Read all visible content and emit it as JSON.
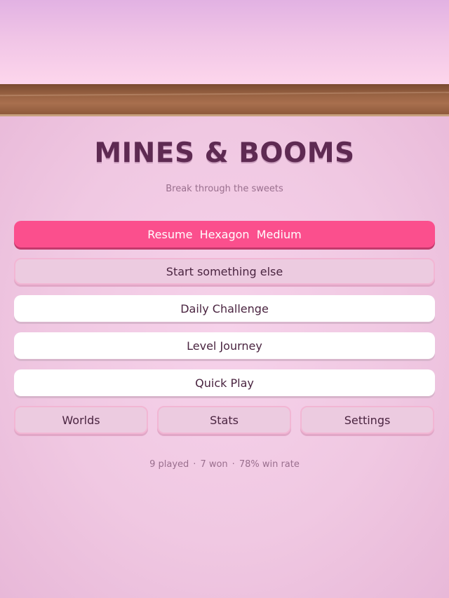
{
  "app": {
    "title": "MINES & BOOMS",
    "subtitle": "Break through the sweets"
  },
  "menu": {
    "resume_label": "Resume  Hexagon  Medium",
    "start_label": "Start something else",
    "daily_label": "Daily Challenge",
    "journey_label": "Level Journey",
    "quick_label": "Quick Play"
  },
  "nav": {
    "worlds_label": "Worlds",
    "stats_label": "Stats",
    "settings_label": "Settings"
  },
  "summary": {
    "played": "9 played",
    "won": "7 won",
    "win_rate": "78% win rate",
    "separator": "·"
  },
  "colors": {
    "accent": "#fb4f8d",
    "title": "#5e2a52",
    "background": "#f1c9e3",
    "shelf": "#9a6444"
  }
}
